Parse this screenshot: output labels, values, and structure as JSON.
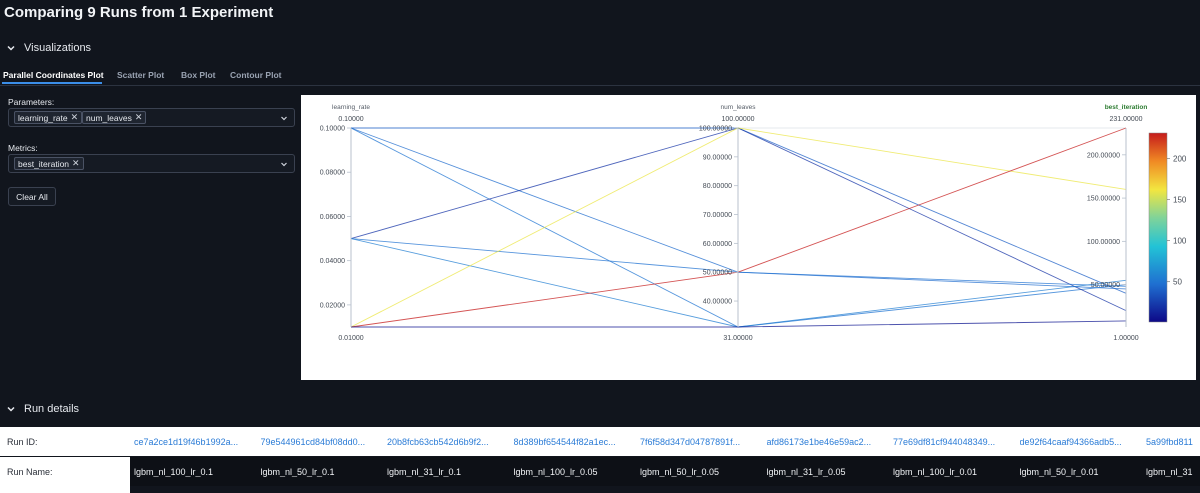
{
  "page_title": "Comparing 9 Runs from 1 Experiment",
  "sections": {
    "visualizations": "Visualizations",
    "run_details": "Run details"
  },
  "tabs": [
    "Parallel Coordinates Plot",
    "Scatter Plot",
    "Box Plot",
    "Contour Plot"
  ],
  "controls": {
    "parameters_label": "Parameters:",
    "parameters_chips": [
      "learning_rate",
      "num_leaves"
    ],
    "metrics_label": "Metrics:",
    "metrics_chips": [
      "best_iteration"
    ],
    "clear_all": "Clear All"
  },
  "colors": {
    "background": "#11151d",
    "accent": "#3b8ee8",
    "link": "#2a7bd6",
    "metric_label": "#2e7d32"
  },
  "chart_data": {
    "type": "parallel_coordinates",
    "axes": [
      {
        "name": "learning_rate",
        "top_label": "0.10000",
        "bottom_label": "0.01000",
        "range": [
          0.01,
          0.1
        ],
        "ticks": [
          "0.10000",
          "0.08000",
          "0.06000",
          "0.04000",
          "0.02000"
        ]
      },
      {
        "name": "num_leaves",
        "top_label": "100.00000",
        "bottom_label": "31.00000",
        "range": [
          31,
          100
        ],
        "ticks": [
          "100.00000",
          "90.00000",
          "80.00000",
          "70.00000",
          "60.00000",
          "50.00000",
          "40.00000"
        ]
      },
      {
        "name": "best_iteration",
        "top_label": "231.00000",
        "bottom_label": "1.00000",
        "range": [
          1,
          231
        ],
        "ticks": [
          "200.00000",
          "150.00000",
          "100.00000",
          "50.00000"
        ]
      }
    ],
    "colorscale": {
      "range": [
        1,
        231
      ],
      "ticks": [
        "200",
        "150",
        "100",
        "50"
      ]
    },
    "runs": [
      {
        "learning_rate": 0.1,
        "num_leaves": 100,
        "best_iteration": 40
      },
      {
        "learning_rate": 0.1,
        "num_leaves": 50,
        "best_iteration": 45
      },
      {
        "learning_rate": 0.1,
        "num_leaves": 31,
        "best_iteration": 50
      },
      {
        "learning_rate": 0.05,
        "num_leaves": 100,
        "best_iteration": 20
      },
      {
        "learning_rate": 0.05,
        "num_leaves": 50,
        "best_iteration": 48
      },
      {
        "learning_rate": 0.05,
        "num_leaves": 31,
        "best_iteration": 55
      },
      {
        "learning_rate": 0.01,
        "num_leaves": 100,
        "best_iteration": 160
      },
      {
        "learning_rate": 0.01,
        "num_leaves": 50,
        "best_iteration": 231
      },
      {
        "learning_rate": 0.01,
        "num_leaves": 31,
        "best_iteration": 8
      }
    ]
  },
  "run_details": {
    "run_id_label": "Run ID:",
    "run_name_label": "Run Name:",
    "run_ids": [
      "ce7a2ce1d19f46b1992a...",
      "79e544961cd84bf08dd0...",
      "20b8fcb63cb542d6b9f2...",
      "8d389bf654544f82a1ec...",
      "7f6f58d347d04787891f...",
      "afd86173e1be46e59ac2...",
      "77e69df81cf944048349...",
      "de92f64caaf94366adb5...",
      "5a99fbd811"
    ],
    "run_names": [
      "lgbm_nl_100_lr_0.1",
      "lgbm_nl_50_lr_0.1",
      "lgbm_nl_31_lr_0.1",
      "lgbm_nl_100_lr_0.05",
      "lgbm_nl_50_lr_0.05",
      "lgbm_nl_31_lr_0.05",
      "lgbm_nl_100_lr_0.01",
      "lgbm_nl_50_lr_0.01",
      "lgbm_nl_31"
    ]
  }
}
